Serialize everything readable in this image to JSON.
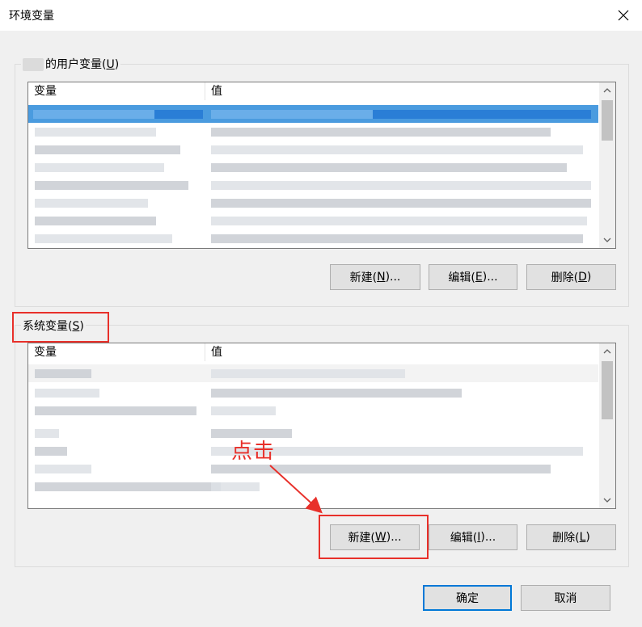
{
  "window": {
    "title": "环境变量"
  },
  "user_group": {
    "label_prefix": "的用户变量(",
    "label_mnemonic": "U",
    "label_suffix": ")",
    "columns": [
      "变量",
      "值"
    ],
    "buttons": {
      "new": {
        "text": "新建(",
        "mn": "N",
        "tail": ")..."
      },
      "edit": {
        "text": "编辑(",
        "mn": "E",
        "tail": ")..."
      },
      "delete": {
        "text": "删除(",
        "mn": "D",
        "tail": ")"
      }
    }
  },
  "system_group": {
    "label_prefix": "系统变量(",
    "label_mnemonic": "S",
    "label_suffix": ")",
    "columns": [
      "变量",
      "值"
    ],
    "buttons": {
      "new": {
        "text": "新建(",
        "mn": "W",
        "tail": ")..."
      },
      "edit": {
        "text": "编辑(",
        "mn": "I",
        "tail": ")..."
      },
      "delete": {
        "text": "删除(",
        "mn": "L",
        "tail": ")"
      }
    }
  },
  "footer": {
    "ok": "确定",
    "cancel": "取消"
  },
  "annotation": {
    "text": "点击",
    "color": "#e8302a"
  },
  "colors": {
    "selection": "#4a9bdf",
    "default_button_border": "#0078d7"
  }
}
